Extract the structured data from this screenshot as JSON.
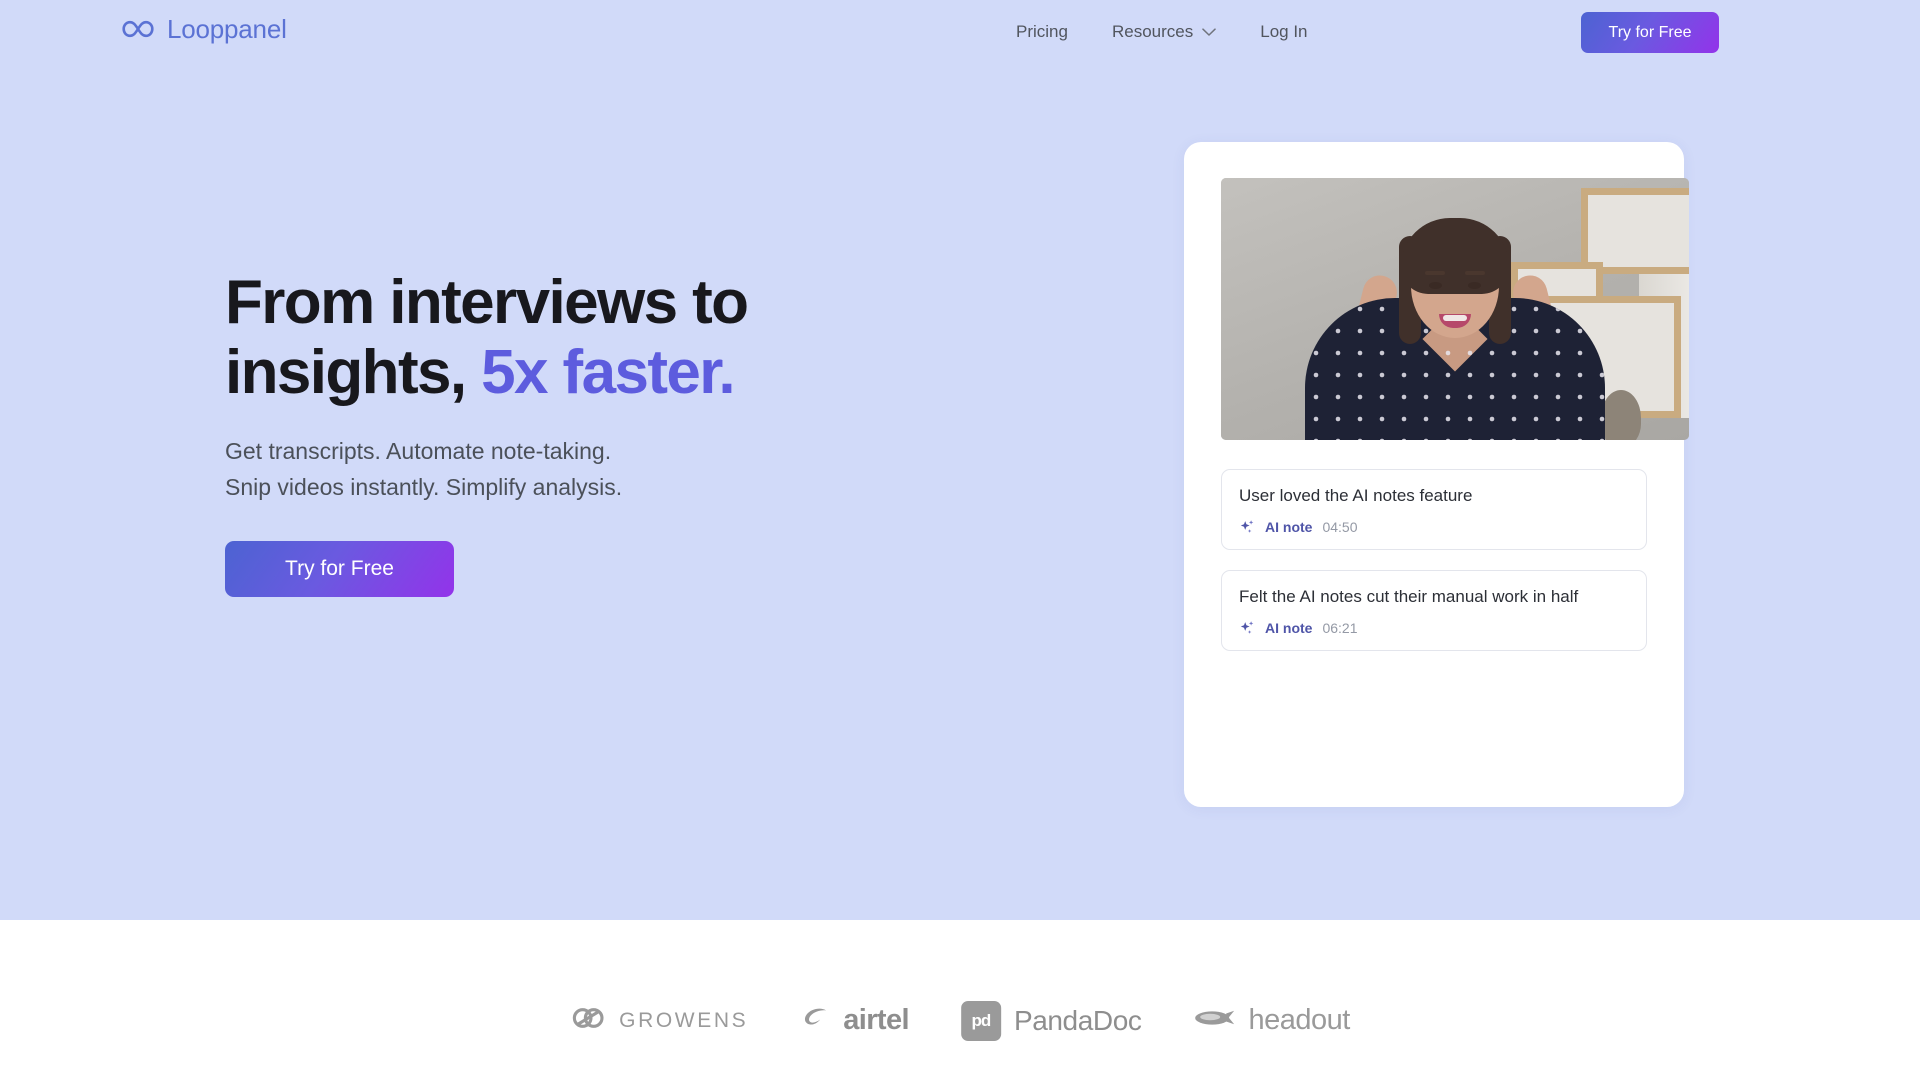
{
  "brand": {
    "name": "Looppanel",
    "logo_icon": "infinity-icon",
    "color": "#5b72d4"
  },
  "nav": {
    "links": [
      {
        "label": "Pricing",
        "icon": null
      },
      {
        "label": "Resources",
        "icon": "chevron-down-icon"
      },
      {
        "label": "Log In",
        "icon": null
      }
    ],
    "cta_label": "Try for Free",
    "cta_gradient_from": "#4c63d2",
    "cta_gradient_to": "#9333ea"
  },
  "hero": {
    "headline_line1": "From interviews to",
    "headline_line2_plain": "insights, ",
    "headline_line2_accent": "5x faster.",
    "accent_color": "#5d5cde",
    "subhead_line1": "Get transcripts. Automate note-taking.",
    "subhead_line2": "Snip videos instantly. Simplify analysis.",
    "cta_label": "Try for Free",
    "background_color": "#d1daf9"
  },
  "media_card": {
    "video": {
      "alt": "Woman in navy polka-dot blouse speaking to camera in a room with wooden wall shelves",
      "icon": "video-thumbnail"
    },
    "notes": [
      {
        "text": "User loved the AI notes feature",
        "icon": "sparkle-icon",
        "label": "AI note",
        "time": "04:50"
      },
      {
        "text": "Felt the AI notes cut their manual work in half",
        "icon": "sparkle-icon",
        "label": "AI note",
        "time": "06:21"
      }
    ],
    "label_color": "#4f55a8"
  },
  "logos": [
    {
      "name": "GROWENS",
      "icon": "growens-link-icon"
    },
    {
      "name": "airtel",
      "icon": "airtel-swoosh-icon"
    },
    {
      "name": "PandaDoc",
      "icon": "pandadoc-badge-icon",
      "badge_text": "pd"
    },
    {
      "name": "headout",
      "icon": "headout-blimp-icon"
    }
  ]
}
